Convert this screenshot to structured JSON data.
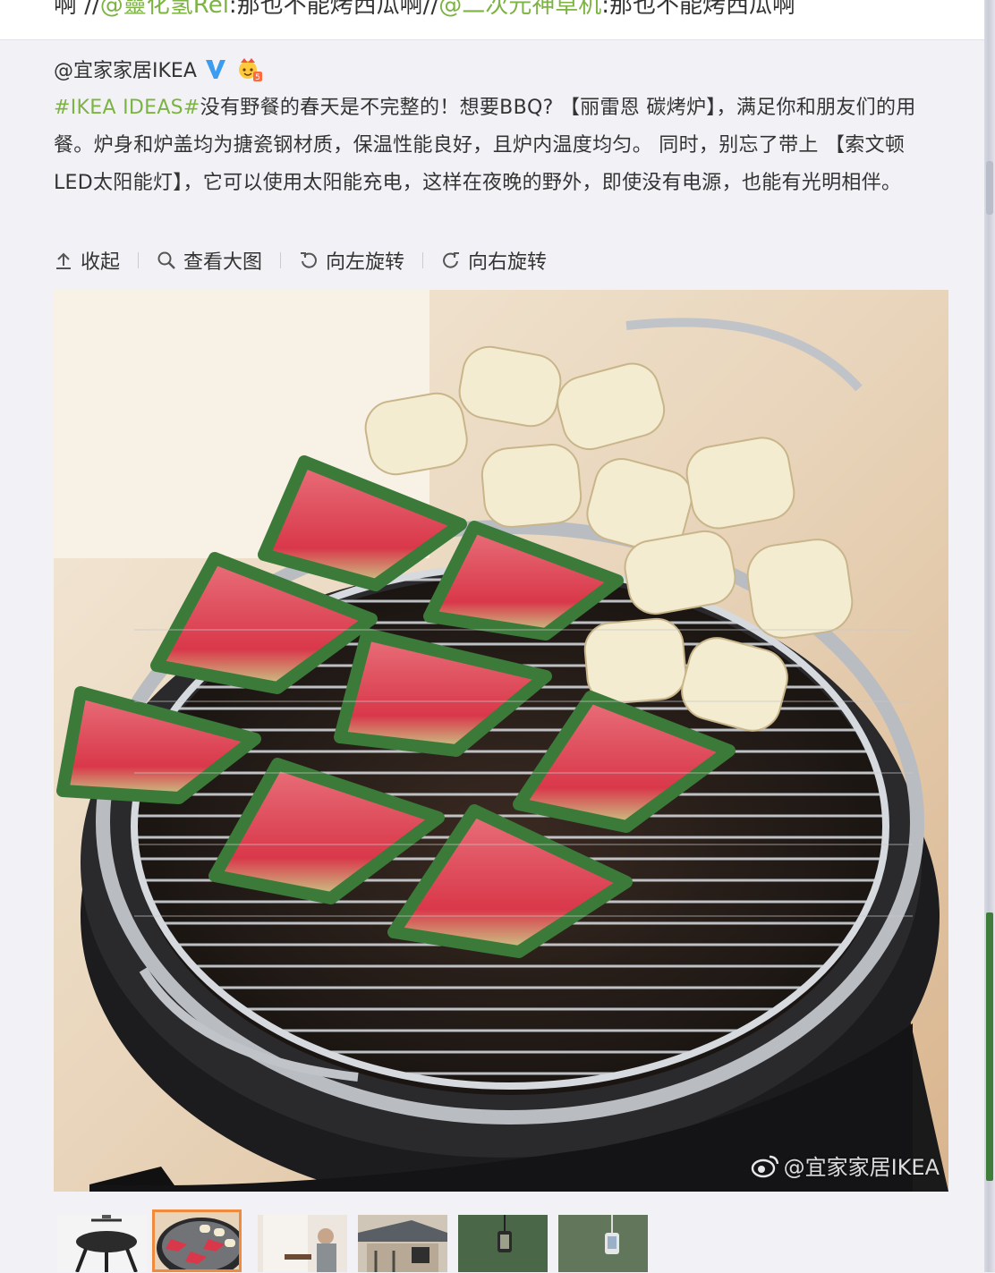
{
  "top_strip": {
    "prefix": "啊 //",
    "mention1": "@靈化氢Rei",
    "text1": ":那也不能烤西瓜啊//",
    "mention2": "@二次元神草机",
    "text2": ":那也不能烤西瓜啊"
  },
  "post": {
    "author": "@宜家家居IKEA",
    "verified_icon": "blue-v-icon",
    "member_icon": "crown-member-icon",
    "topic": "#IKEA IDEAS#",
    "body": "没有野餐的春天是不完整的！想要BBQ? 【丽雷恩 碳烤炉】，满足你和朋友们的用餐。炉身和炉盖均为搪瓷钢材质，保温性能良好，且炉内温度均匀。 同时，别忘了带上 【索文顿 LED太阳能灯】，它可以使用太阳能充电，这样在夜晚的野外，即使没有电源，也能有光明相伴。"
  },
  "actions": [
    {
      "label": "收起",
      "icon": "collapse-icon"
    },
    {
      "label": "查看大图",
      "icon": "search-icon"
    },
    {
      "label": "向左旋转",
      "icon": "rotate-left-icon"
    },
    {
      "label": "向右旋转",
      "icon": "rotate-right-icon"
    }
  ],
  "photo": {
    "watermark": "@宜家家居IKEA",
    "watermark_icon": "weibo-logo-icon"
  },
  "thumbnails": {
    "count": 6,
    "active_index": 1
  },
  "colors": {
    "link_green": "#7cb342",
    "active_border": "#f08a3c"
  }
}
